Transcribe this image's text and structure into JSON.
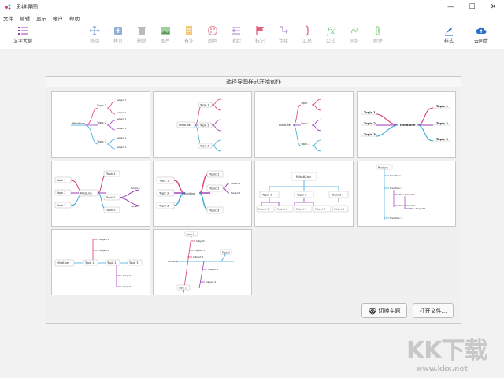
{
  "window": {
    "title": "思维导图",
    "controls": [
      "—",
      "☐",
      "✕"
    ]
  },
  "menu": [
    "文件",
    "编辑",
    "显示",
    "帐户",
    "帮助"
  ],
  "toolbar": {
    "left": {
      "label": "文字大纲",
      "icon": "outline-icon"
    },
    "items": [
      {
        "label": "移动",
        "icon": "move-icon"
      },
      {
        "label": "拷贝",
        "icon": "copy-icon"
      },
      {
        "label": "删除",
        "icon": "delete-icon"
      },
      {
        "label": "图片",
        "icon": "image-icon"
      },
      {
        "label": "备注",
        "icon": "note-icon"
      },
      {
        "label": "颜色",
        "icon": "palette-icon"
      },
      {
        "label": "收起",
        "icon": "collapse-icon"
      },
      {
        "label": "标记",
        "icon": "flag-icon"
      },
      {
        "label": "连接",
        "icon": "connect-icon"
      },
      {
        "label": "汇总",
        "icon": "summary-icon"
      },
      {
        "label": "公式",
        "icon": "formula-icon"
      },
      {
        "label": "网址",
        "icon": "link-icon"
      },
      {
        "label": "附件",
        "icon": "attachment-icon"
      }
    ],
    "right": [
      {
        "label": "样式",
        "icon": "style-icon"
      },
      {
        "label": "云同步",
        "icon": "cloud-sync-icon"
      }
    ]
  },
  "panel": {
    "title": "选择导图样式开始创作",
    "switch_theme": "切换主题",
    "open_file": "打开文件..."
  },
  "thumbs": {
    "center": "MindLine",
    "topic1": "Topic 1",
    "topic2": "Topic 2",
    "topic3": "Topic 3",
    "subject1": "Subject 1",
    "subject2": "Subject 2",
    "tree_topic1": "Tree Topic 1",
    "tree_topic2": "Tree Topic 2",
    "tree_topic3": "Tree Topic 3",
    "tree_subject1": "Tree Subject 1",
    "tree_subject2": "Tree Subject 2"
  },
  "watermark": {
    "big": "KK下载",
    "small": "www.kkx.net"
  },
  "colors": {
    "pink": "#d63a7a",
    "blue": "#3aa8d8",
    "purple": "#9a3ab8",
    "teal": "#2fb3c0"
  }
}
